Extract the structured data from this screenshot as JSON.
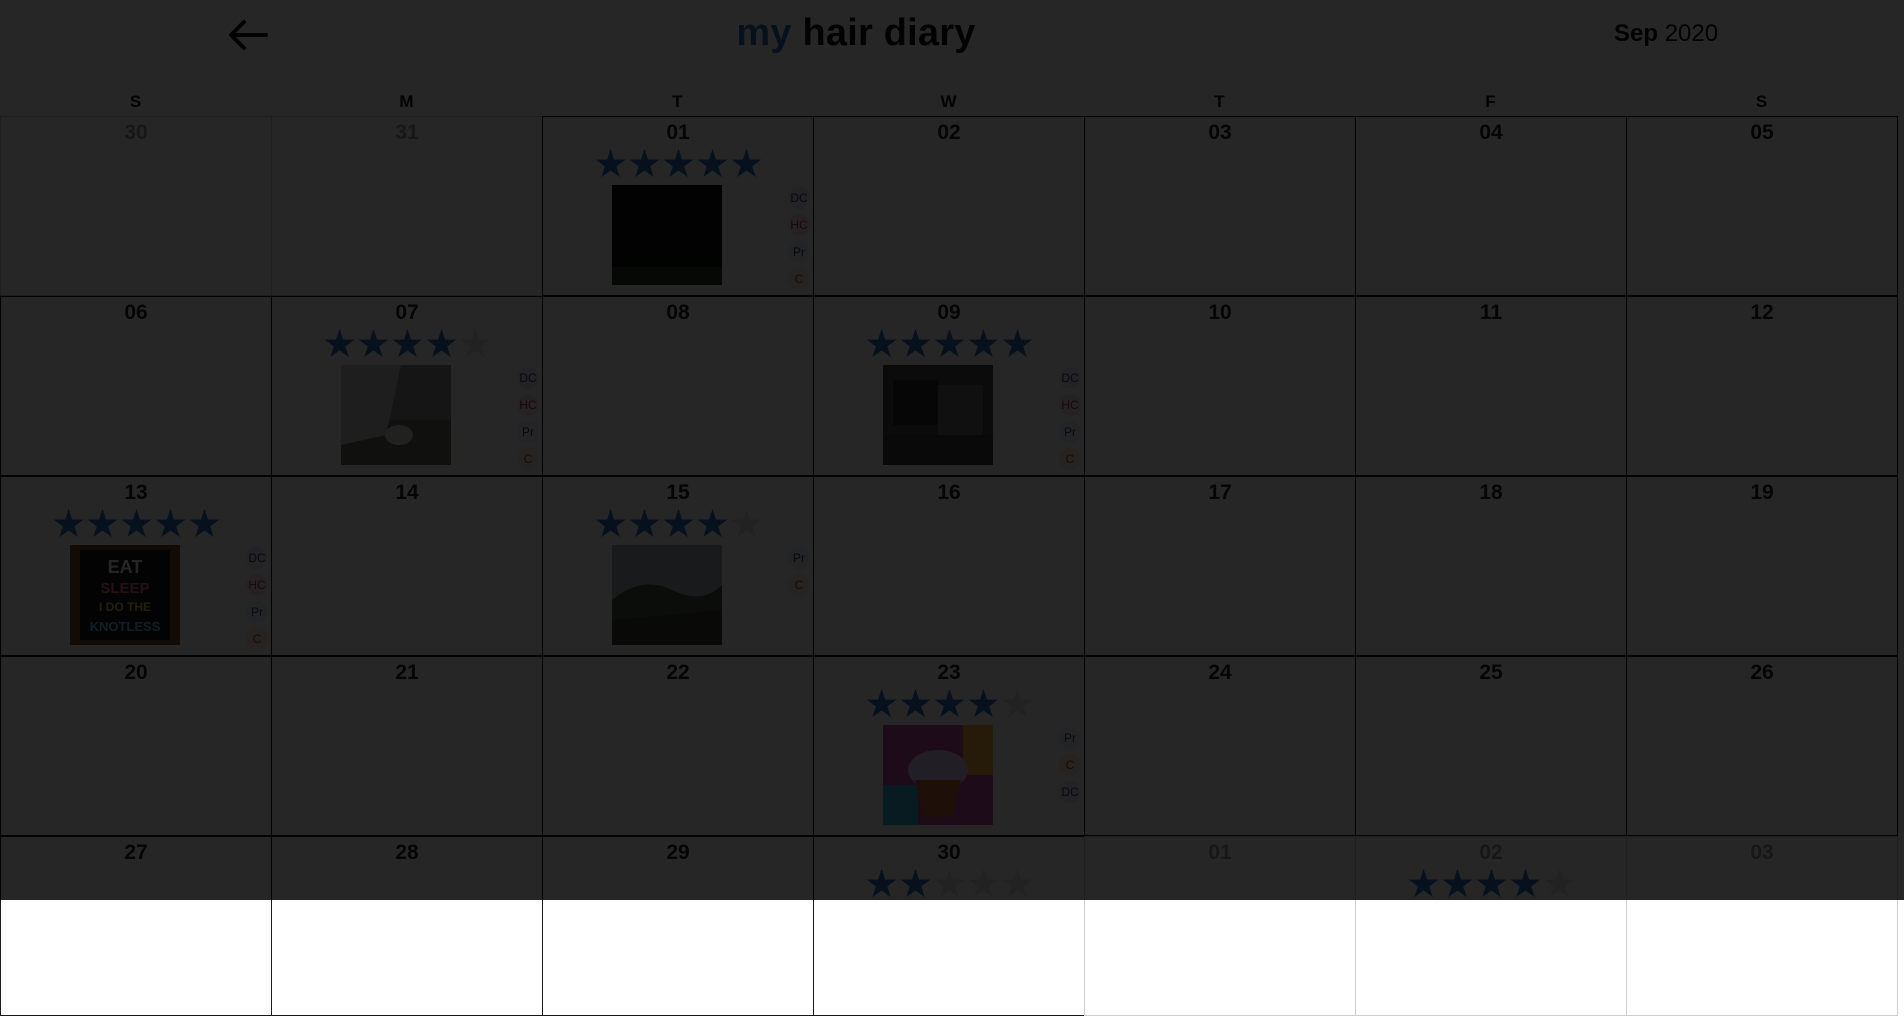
{
  "header": {
    "back_icon": "arrow-left-icon",
    "title_my": "my",
    "title_rest": "hair diary",
    "month": "Sep",
    "year": "2020",
    "colors": {
      "accent": "#2f73c2",
      "star_off": "#e2e2e2"
    }
  },
  "weekdays": [
    "S",
    "M",
    "T",
    "W",
    "T",
    "F",
    "S"
  ],
  "days": [
    {
      "label": "30",
      "other": true
    },
    {
      "label": "31",
      "other": true
    },
    {
      "label": "01",
      "rating": 5,
      "photo": "black",
      "badges": [
        "DC",
        "HC",
        "Pr",
        "C"
      ]
    },
    {
      "label": "02"
    },
    {
      "label": "03"
    },
    {
      "label": "04"
    },
    {
      "label": "05"
    },
    {
      "label": "06"
    },
    {
      "label": "07",
      "rating": 4,
      "photo": "lamp",
      "badges": [
        "DC",
        "HC",
        "Pr",
        "C"
      ]
    },
    {
      "label": "08"
    },
    {
      "label": "09",
      "rating": 5,
      "photo": "room",
      "badges": [
        "DC",
        "HC",
        "Pr",
        "C"
      ]
    },
    {
      "label": "10"
    },
    {
      "label": "11"
    },
    {
      "label": "12"
    },
    {
      "label": "13",
      "rating": 5,
      "photo": "sign",
      "badges": [
        "DC",
        "HC",
        "Pr",
        "C"
      ]
    },
    {
      "label": "14"
    },
    {
      "label": "15",
      "rating": 4,
      "photo": "landscape",
      "badges": [
        "Pr",
        "C"
      ]
    },
    {
      "label": "16"
    },
    {
      "label": "17"
    },
    {
      "label": "18"
    },
    {
      "label": "19"
    },
    {
      "label": "20"
    },
    {
      "label": "21"
    },
    {
      "label": "22"
    },
    {
      "label": "23",
      "rating": 4,
      "photo": "cupcake",
      "badges": [
        "Pr",
        "C",
        "DC"
      ]
    },
    {
      "label": "24"
    },
    {
      "label": "25"
    },
    {
      "label": "26"
    },
    {
      "label": "27"
    },
    {
      "label": "28"
    },
    {
      "label": "29"
    },
    {
      "label": "30",
      "rating": 2
    },
    {
      "label": "01",
      "other": true
    },
    {
      "label": "02",
      "other": true,
      "rating": 4
    },
    {
      "label": "03",
      "other": true
    }
  ],
  "photo_subjects": {
    "black": "dark-photo",
    "lamp": "lamp-photo",
    "room": "room-photo",
    "sign": "sign-photo",
    "landscape": "landscape-photo",
    "cupcake": "cupcake-photo"
  },
  "sign_text": "EAT SLEEP I DO THE KNOTLESS"
}
